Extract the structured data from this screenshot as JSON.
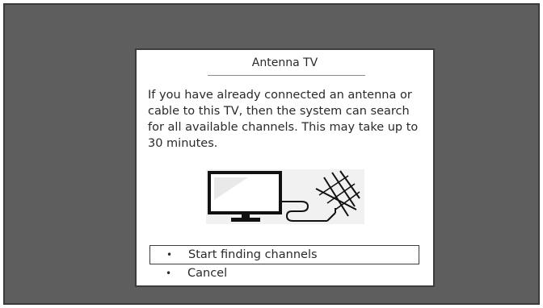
{
  "dialog": {
    "title": "Antenna TV",
    "body": "If you have already connected an antenna or cable to this TV, then the system can search for all available channels. This may take up to 30 minutes."
  },
  "illustration": {
    "tv_icon": "tv-icon",
    "antenna_icon": "antenna-icon"
  },
  "options": [
    {
      "bullet": "•",
      "label": "Start finding channels",
      "selected": true
    },
    {
      "bullet": "•",
      "label": "Cancel",
      "selected": false
    }
  ]
}
